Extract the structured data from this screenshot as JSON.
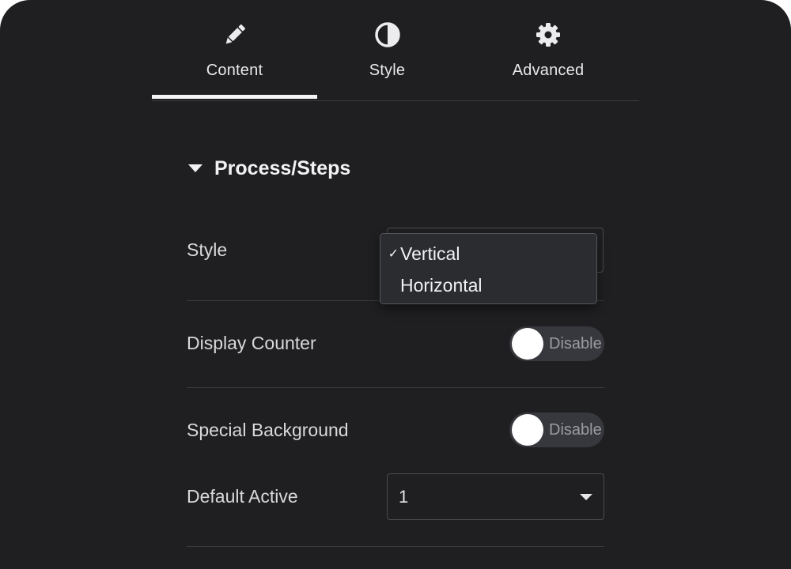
{
  "tabs": [
    {
      "label": "Content",
      "icon": "pencil-icon",
      "active": true
    },
    {
      "label": "Style",
      "icon": "half-circle-icon",
      "active": false
    },
    {
      "label": "Advanced",
      "icon": "gear-icon",
      "active": false
    }
  ],
  "section": {
    "title": "Process/Steps"
  },
  "fields": {
    "style": {
      "label": "Style",
      "options": [
        "Vertical",
        "Horizontal"
      ],
      "selected": "Vertical",
      "check_mark": "✓"
    },
    "display_counter": {
      "label": "Display Counter",
      "toggle_text": "Disable"
    },
    "special_background": {
      "label": "Special Background",
      "toggle_text": "Disable"
    },
    "default_active": {
      "label": "Default Active",
      "value": "1"
    }
  },
  "colors": {
    "background": "#1f1f21",
    "text": "#d9d9dc",
    "divider": "#3a3b3f",
    "dropdown_bg": "#2b2c30"
  }
}
